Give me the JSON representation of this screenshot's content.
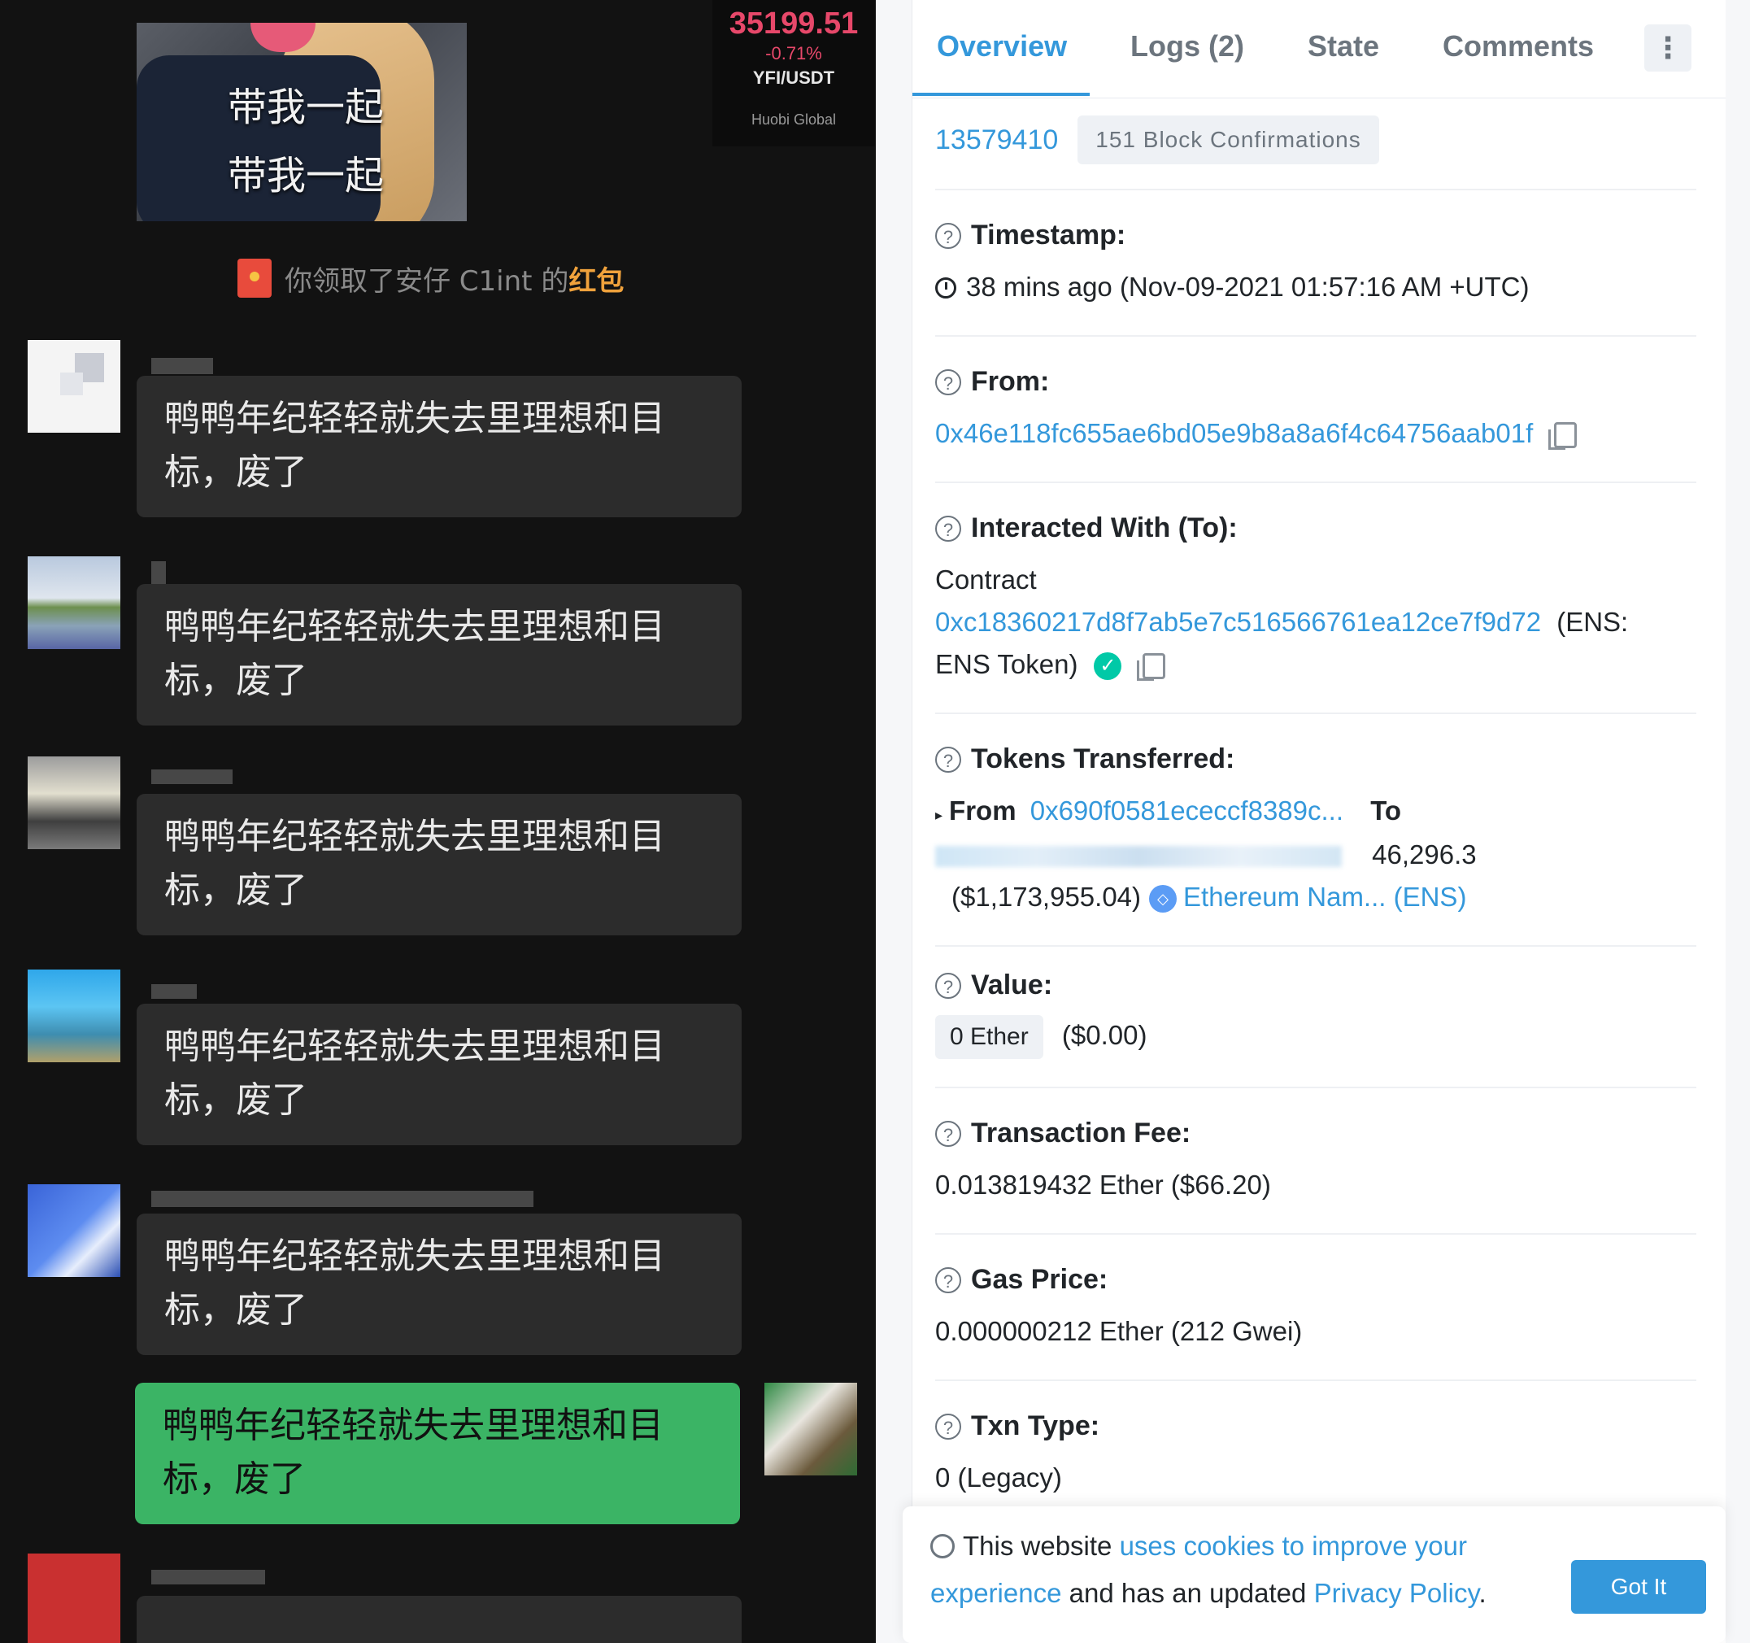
{
  "chat": {
    "sticker_text": [
      "带我一起",
      "带我一起"
    ],
    "ticker": {
      "price": "35199.51",
      "change": "-0.71%",
      "pair": "YFI/USDT",
      "exchange": "Huobi Global"
    },
    "red_packet": {
      "text": "你领取了安仔 C1int 的",
      "highlight": "红包"
    },
    "messages": [
      {
        "text": "鸭鸭年纪轻轻就失去里理想和目标，废了"
      },
      {
        "text": "鸭鸭年纪轻轻就失去里理想和目标，废了"
      },
      {
        "text": "鸭鸭年纪轻轻就失去里理想和目标，废了"
      },
      {
        "text": "鸭鸭年纪轻轻就失去里理想和目标，废了"
      },
      {
        "text": "鸭鸭年纪轻轻就失去里理想和目标，废了"
      }
    ],
    "my_message": {
      "text": "鸭鸭年纪轻轻就失去里理想和目标，废了"
    }
  },
  "tx": {
    "tabs": [
      "Overview",
      "Logs (2)",
      "State",
      "Comments"
    ],
    "active_tab": "Overview",
    "more_icon": "vertical-dots-icon",
    "block": "13579410",
    "confirmations": "151 Block Confirmations",
    "timestamp_label": "Timestamp:",
    "timestamp": "38 mins ago (Nov-09-2021 01:57:16 AM +UTC)",
    "from_label": "From:",
    "from": "0x46e118fc655ae6bd05e9b8a8a6f4c64756aab01f",
    "to_label": "Interacted With (To):",
    "contract_word": "Contract",
    "contract_addr": "0xc18360217d8f7ab5e7c516566761ea12ce7f9d72",
    "ens_prefix": "(ENS:",
    "ens_suffix": "ENS Token)",
    "tokens_label": "Tokens Transferred:",
    "tt_from_word": "From",
    "tt_from_addr": "0x690f0581ececcf8389c...",
    "tt_to_word": "To",
    "tt_amount": "46,296.3",
    "tt_usd": "($1,173,955.04)",
    "tt_token": "Ethereum Nam... (ENS)",
    "value_label": "Value:",
    "value_ether": "0 Ether",
    "value_usd": "($0.00)",
    "fee_label": "Transaction Fee:",
    "fee": "0.013819432 Ether ($66.20)",
    "gas_label": "Gas Price:",
    "gas": "0.000000212 Ether (212 Gwei)",
    "type_label": "Txn Type:",
    "type": "0 (Legacy)",
    "colors": {
      "link": "#3498db",
      "verified": "#00c9a7"
    }
  },
  "cookie": {
    "text1": "This website",
    "link1": "uses cookies to improve your experience",
    "text2": "and has an updated",
    "link2": "Privacy Policy",
    "text3": ".",
    "button": "Got It"
  }
}
